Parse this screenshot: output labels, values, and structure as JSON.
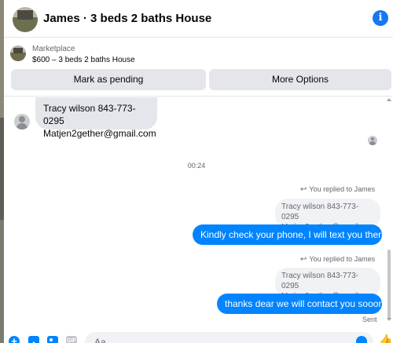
{
  "header": {
    "title": "James · 3 beds 2 baths House",
    "info_icon": "info-icon"
  },
  "marketplace": {
    "label": "Marketplace",
    "item": "$600 – 3 beds 2 baths House",
    "mark_pending_label": "Mark as pending",
    "more_options_label": "More Options"
  },
  "messages": {
    "incoming": {
      "line1": "Tracy wilson 843-773-0295",
      "line2": "Matjen2gether@gmail.com"
    },
    "timestamp": "00:24",
    "replies": [
      {
        "meta": "You replied to James",
        "quoted_line1": "Tracy wilson 843-773-0295",
        "quoted_line2": "Matjen2gether@gmail.com",
        "text": "Kindly check your phone, I will text you there"
      },
      {
        "meta": "You replied to James",
        "quoted_line1": "Tracy wilson 843-773-0295",
        "quoted_line2": "Matjen2gether@gmail.com",
        "text": "thanks dear we will contact you sooon"
      }
    ],
    "status": "Sent"
  },
  "composer": {
    "placeholder": "Aa"
  },
  "colors": {
    "accent": "#0084ff",
    "info": "#1877f2",
    "bubble_in": "#e4e6eb",
    "quoted": "#f0f2f5"
  }
}
